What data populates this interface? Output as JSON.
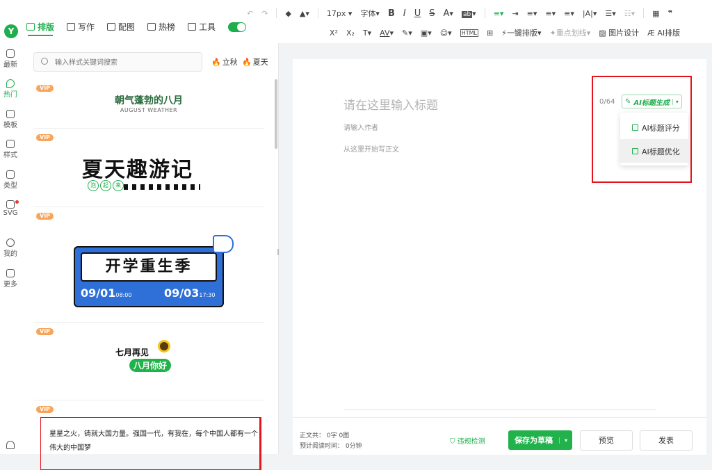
{
  "rail": {
    "logo": "Y",
    "items": [
      {
        "label": "最新",
        "icon": "latest-icon"
      },
      {
        "label": "热门",
        "icon": "hot-icon",
        "active": true
      },
      {
        "label": "模板",
        "icon": "template-icon"
      },
      {
        "label": "样式",
        "icon": "style-icon"
      },
      {
        "label": "类型",
        "icon": "type-icon"
      },
      {
        "label": "SVG",
        "icon": "svg-icon"
      },
      {
        "label": "我的",
        "icon": "user-icon"
      },
      {
        "label": "更多",
        "icon": "more-icon"
      }
    ]
  },
  "tabs": [
    {
      "label": "排版",
      "active": true
    },
    {
      "label": "写作"
    },
    {
      "label": "配图"
    },
    {
      "label": "热榜"
    },
    {
      "label": "工具"
    }
  ],
  "toolbar": {
    "undo": "↶",
    "redo": "↷",
    "font_size": "17px",
    "font_family": "字体",
    "bold": "B",
    "italic": "I",
    "underline": "U",
    "strike": "S",
    "font_color": "A",
    "ab": "ab",
    "superscript": "X²",
    "subscript": "X₂",
    "spacing": "AV",
    "one_click_layout": "一键排版",
    "key_line": "重点划线",
    "image_design": "图片设计",
    "ai_layout": "AI排版"
  },
  "search": {
    "placeholder": "输入样式关键词搜索"
  },
  "hot_tags": [
    "立秋",
    "夏天"
  ],
  "cards": {
    "vip": "VIP",
    "c1_title": "朝气蓬勃的八月",
    "c1_sub": "AUGUST WEATHER",
    "c2_title": "夏天趣游记",
    "c2_pills": [
      "泡",
      "起",
      "来"
    ],
    "c3_title": "开学重生季",
    "c3_date1": "09/01",
    "c3_time1": "08:00",
    "c3_date2": "09/03",
    "c3_time2": "17:30",
    "c4_line1": "七月再见",
    "c4_line2": "八月你好",
    "c5_text": "星星之火，铸就大国力量。强国一代，有我在，每个中国人都有一个伟大的中国梦"
  },
  "editor": {
    "title_placeholder": "请在这里输入标题",
    "author_placeholder": "请输入作者",
    "body_placeholder": "从这里开始写正文",
    "title_count": "0/64",
    "ai_button": "AI标题生成",
    "ai_menu": [
      "AI标题评分",
      "AI标题优化"
    ]
  },
  "footer": {
    "stats_line1": "正文共：  0字 0图",
    "stats_line2": "预计阅读时间：  0分钟",
    "violation_check": "违规检测",
    "save_draft": "保存为草稿",
    "preview": "预览",
    "publish": "发表"
  },
  "colors": {
    "accent": "#1fae4c",
    "highlight": "#e3141c",
    "vip": "#f7a55a"
  }
}
